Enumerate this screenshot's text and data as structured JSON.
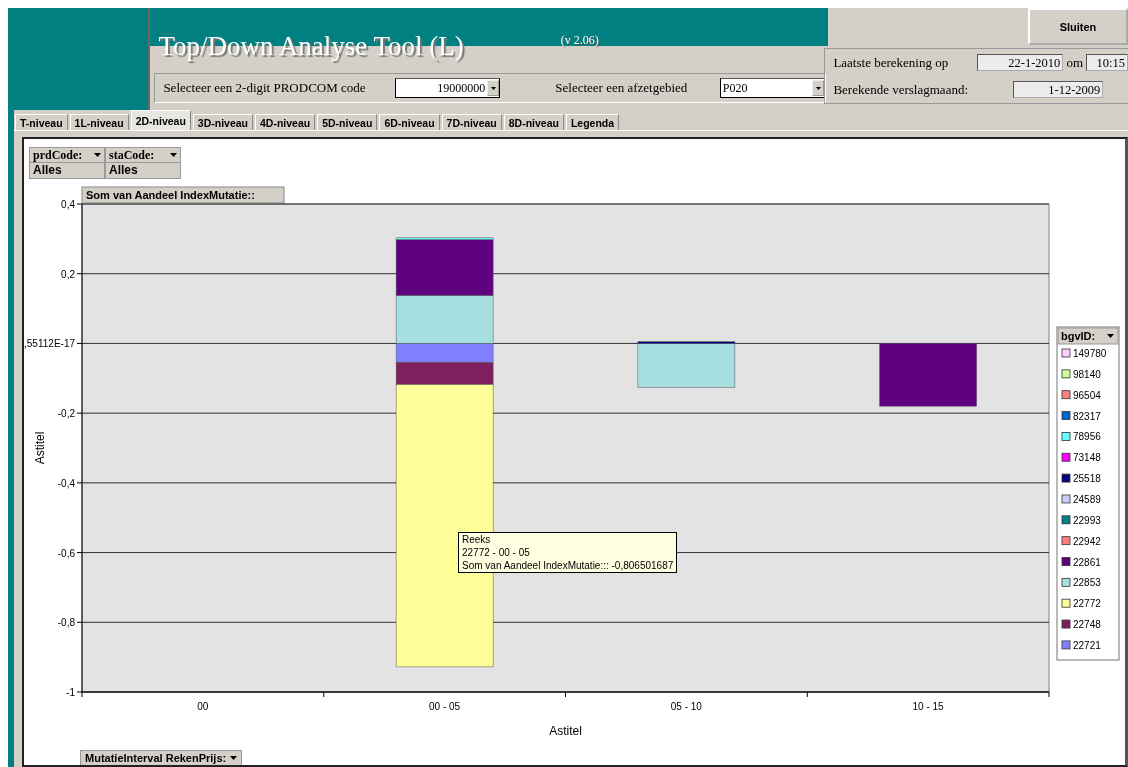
{
  "header": {
    "title": "Top/Down Analyse Tool (L)",
    "version": "(v 2.06)",
    "close_button": "Sluiten"
  },
  "selectors": [
    {
      "label": "Selecteer een 2-digit PRODCOM code",
      "value": "19000000"
    },
    {
      "label": "Selecteer een afzetgebied",
      "value": "P020"
    }
  ],
  "calculation": {
    "last_label": "Laatste berekening op",
    "date": "22-1-2010",
    "at": "om",
    "time": "10:15",
    "month_label": "Berekende verslagmaand:",
    "month": "1-12-2009"
  },
  "tabs": [
    {
      "label": "T-niveau",
      "selected": false
    },
    {
      "label": "1L-niveau",
      "selected": false
    },
    {
      "label": "2D-niveau",
      "selected": true
    },
    {
      "label": "3D-niveau",
      "selected": false
    },
    {
      "label": "4D-niveau",
      "selected": false
    },
    {
      "label": "5D-niveau",
      "selected": false
    },
    {
      "label": "6D-niveau",
      "selected": false
    },
    {
      "label": "7D-niveau",
      "selected": false
    },
    {
      "label": "8D-niveau",
      "selected": false
    },
    {
      "label": "Legenda",
      "selected": false
    }
  ],
  "pivot": {
    "page_fields": [
      {
        "name": "prdCode:",
        "value": "Alles"
      },
      {
        "name": "staCode:",
        "value": "Alles"
      }
    ],
    "data_field": "Som van Aandeel IndexMutatie::",
    "series_field": "bgvID:",
    "category_field": "MutatieInterval RekenPrijs:"
  },
  "tooltip": {
    "lines": [
      "Reeks",
      "22772 - 00 - 05",
      "Som van Aandeel IndexMutatie::: -0,806501687"
    ]
  },
  "chart_data": {
    "type": "bar",
    "stacked": true,
    "orientation": "vertical",
    "xlabel": "Astitel",
    "ylabel": "Astitel",
    "categories": [
      "00",
      "00 - 05",
      "05 - 10",
      "10 - 15"
    ],
    "ylim": [
      -1,
      0.4
    ],
    "yticks": [
      {
        "value": 0.4,
        "label": "0,4"
      },
      {
        "value": 0.2,
        "label": "0,2"
      },
      {
        "value": 0,
        "label": ",55112E-17"
      },
      {
        "value": -0.2,
        "label": "-0,2"
      },
      {
        "value": -0.4,
        "label": "-0,4"
      },
      {
        "value": -0.6,
        "label": "-0,6"
      },
      {
        "value": -0.8,
        "label": "-0,8"
      },
      {
        "value": -1,
        "label": "-1"
      }
    ],
    "grid": {
      "y": true
    },
    "legend": true,
    "series": [
      {
        "name": "149780",
        "color": "#ffccff",
        "values": [
          null,
          null,
          null,
          null
        ]
      },
      {
        "name": "98140",
        "color": "#ccff99",
        "values": [
          null,
          null,
          null,
          null
        ]
      },
      {
        "name": "96504",
        "color": "#ff8080",
        "values": [
          null,
          null,
          null,
          null
        ]
      },
      {
        "name": "82317",
        "color": "#0066cc",
        "values": [
          null,
          null,
          null,
          null
        ]
      },
      {
        "name": "78956",
        "color": "#66ffff",
        "values": [
          null,
          0.005,
          null,
          null
        ]
      },
      {
        "name": "73148",
        "color": "#ff00ff",
        "values": [
          null,
          null,
          null,
          null
        ]
      },
      {
        "name": "25518",
        "color": "#000080",
        "values": [
          null,
          null,
          0.005,
          null
        ]
      },
      {
        "name": "24589",
        "color": "#ccccff",
        "values": [
          null,
          null,
          null,
          null
        ]
      },
      {
        "name": "22993",
        "color": "#008080",
        "values": [
          null,
          null,
          null,
          null
        ]
      },
      {
        "name": "22942",
        "color": "#ff7c80",
        "values": [
          null,
          null,
          null,
          null
        ]
      },
      {
        "name": "22861",
        "color": "#5f0080",
        "values": [
          null,
          0.16,
          null,
          -0.18
        ]
      },
      {
        "name": "22853",
        "color": "#a6dfe0",
        "values": [
          null,
          0.138,
          -0.126,
          null
        ]
      },
      {
        "name": "22772",
        "color": "#ffff99",
        "values": [
          null,
          -0.81,
          null,
          null
        ]
      },
      {
        "name": "22748",
        "color": "#7f1f5f",
        "values": [
          null,
          -0.063,
          null,
          null
        ]
      },
      {
        "name": "22721",
        "color": "#8080ff",
        "values": [
          null,
          -0.055,
          null,
          null
        ]
      }
    ]
  }
}
